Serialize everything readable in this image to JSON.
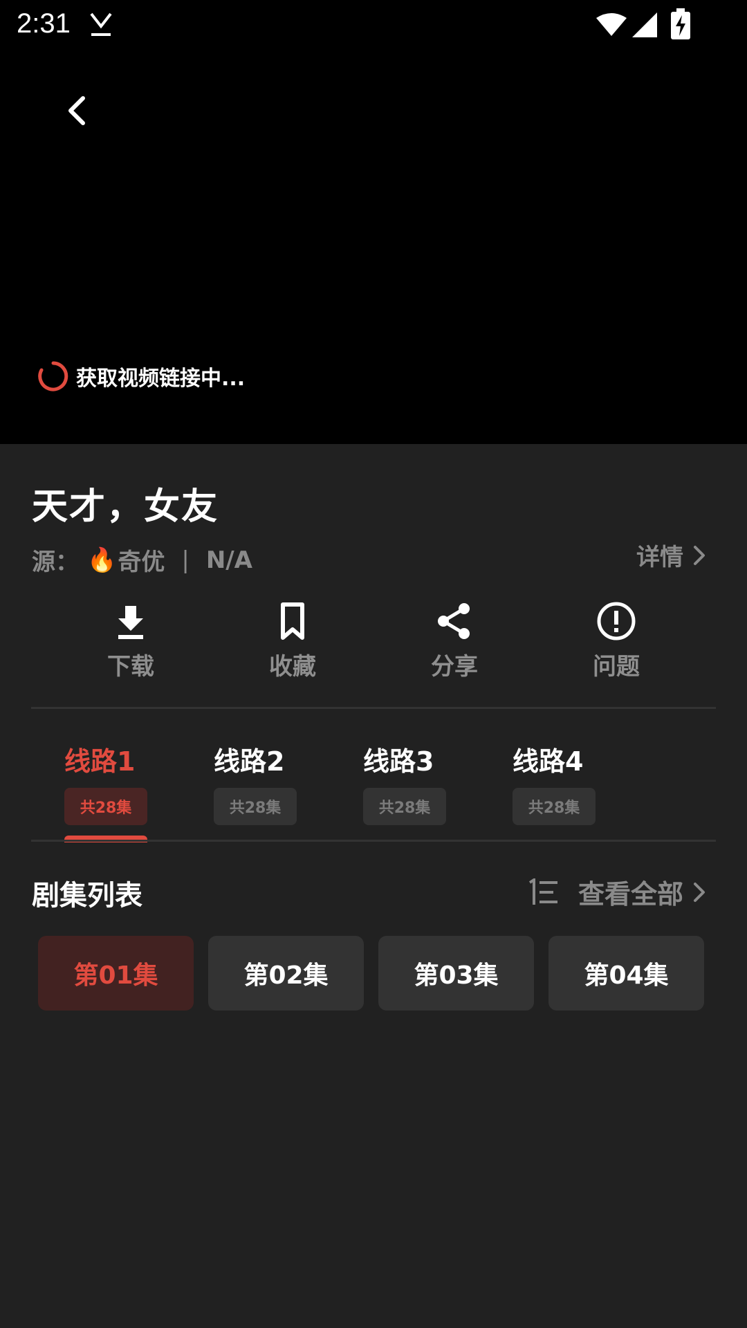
{
  "status_bar": {
    "time": "2:31"
  },
  "player": {
    "loading_text": "获取视频链接中..."
  },
  "info": {
    "title": "天才，女友",
    "source_label": "源：",
    "source_name": "奇优",
    "separator": "|",
    "source_extra": "N/A",
    "detail_label": "详情"
  },
  "actions": [
    {
      "label": "下载",
      "icon": "download-icon"
    },
    {
      "label": "收藏",
      "icon": "bookmark-icon"
    },
    {
      "label": "分享",
      "icon": "share-icon"
    },
    {
      "label": "问题",
      "icon": "report-icon"
    }
  ],
  "lines": [
    {
      "name": "线路1",
      "count": "共28集",
      "active": true
    },
    {
      "name": "线路2",
      "count": "共28集",
      "active": false
    },
    {
      "name": "线路3",
      "count": "共28集",
      "active": false
    },
    {
      "name": "线路4",
      "count": "共28集",
      "active": false
    }
  ],
  "episodes": {
    "title": "剧集列表",
    "view_all": "查看全部",
    "items": [
      {
        "label": "第01集",
        "active": true
      },
      {
        "label": "第02集",
        "active": false
      },
      {
        "label": "第03集",
        "active": false
      },
      {
        "label": "第04集",
        "active": false
      }
    ]
  },
  "colors": {
    "accent": "#e14b3f",
    "background": "#212121",
    "player": "#000000"
  }
}
